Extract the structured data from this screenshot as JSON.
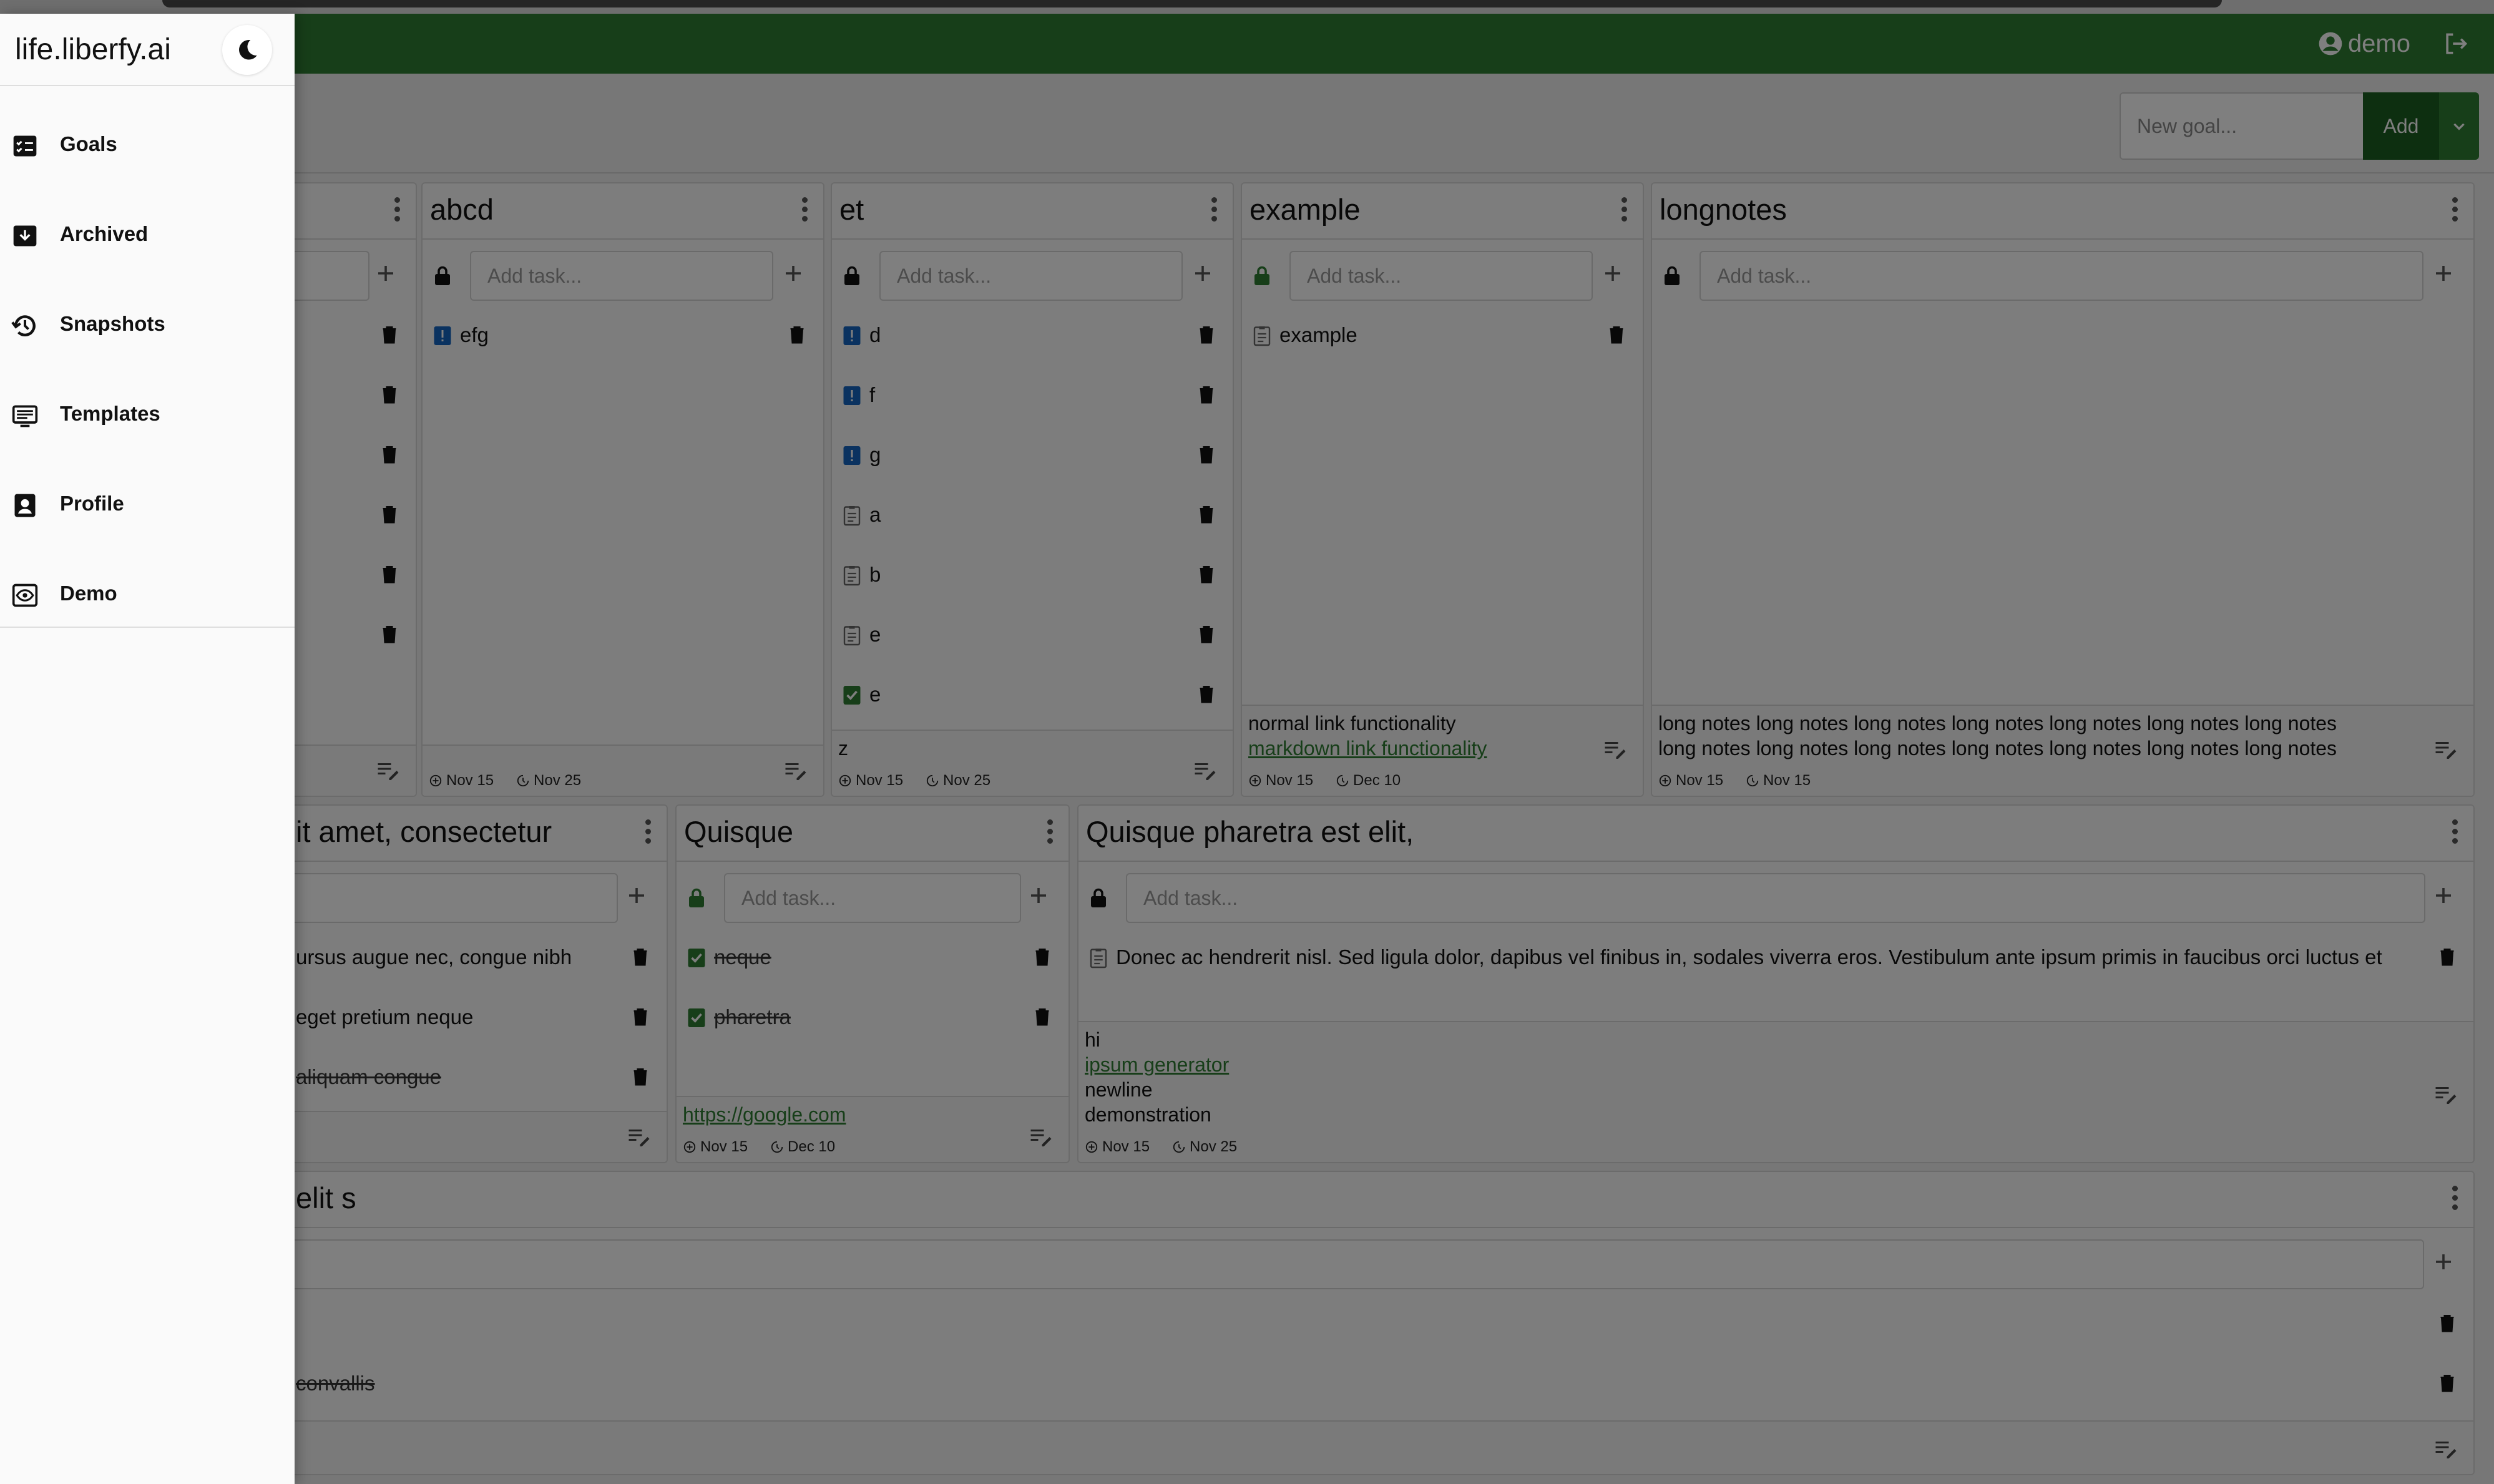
{
  "app": {
    "brand": "life.liberfy.ai",
    "user": "demo"
  },
  "toolbar": {
    "new_goal_placeholder": "New goal...",
    "add_label": "Add"
  },
  "common": {
    "add_task_placeholder": "Add task..."
  },
  "sidebar": {
    "items": [
      {
        "label": "Goals",
        "icon": "goals-checklist-icon"
      },
      {
        "label": "Archived",
        "icon": "archive-box-icon"
      },
      {
        "label": "Snapshots",
        "icon": "history-clock-icon"
      },
      {
        "label": "Templates",
        "icon": "template-list-icon"
      },
      {
        "label": "Profile",
        "icon": "profile-badge-icon"
      },
      {
        "label": "Demo",
        "icon": "demo-eye-icon"
      }
    ]
  },
  "goals": {
    "g0": {
      "title": "",
      "tasks": [
        "",
        "",
        "",
        "",
        "",
        ""
      ],
      "notes": "",
      "created": "",
      "due": ""
    },
    "g1": {
      "title": "abcd",
      "tasks": [
        {
          "text": "efg",
          "icon": "priority"
        }
      ],
      "created": "Nov 15",
      "due": "Nov 25"
    },
    "g2": {
      "title": "et",
      "tasks": [
        {
          "text": "d",
          "icon": "priority"
        },
        {
          "text": "f",
          "icon": "priority"
        },
        {
          "text": "g",
          "icon": "priority"
        },
        {
          "text": "a",
          "icon": "note"
        },
        {
          "text": "b",
          "icon": "note"
        },
        {
          "text": "e",
          "icon": "note"
        },
        {
          "text": "e",
          "icon": "checked"
        }
      ],
      "notes": "z",
      "created": "Nov 15",
      "due": "Nov 25"
    },
    "g3": {
      "title": "example",
      "tasks": [
        {
          "text": "example",
          "icon": "note"
        }
      ],
      "notes_line1": "normal link functionality",
      "notes_link": "markdown link functionality",
      "created": "Nov 15",
      "due": "Dec 10"
    },
    "g4": {
      "title": "longnotes",
      "notes_line1": "long notes long notes long notes long notes long notes long notes long notes",
      "notes_line2": "long notes long notes long notes long notes long notes long notes long notes",
      "created": "Nov 15",
      "due": "Nov 15"
    },
    "g5": {
      "title": "it amet, consectetur",
      "tasks": [
        {
          "text": "ursus augue nec, congue nibh",
          "done": false
        },
        {
          "text": "eget pretium neque",
          "done": false
        },
        {
          "text": "aliquam congue",
          "done": true
        }
      ]
    },
    "g6": {
      "title": "Quisque",
      "tasks": [
        {
          "text": "neque",
          "icon": "checked",
          "done": true
        },
        {
          "text": "pharetra",
          "icon": "checked",
          "done": true
        }
      ],
      "notes_link": "https://google.com",
      "created": "Nov 15",
      "due": "Dec 10"
    },
    "g7": {
      "title": "Quisque pharetra est elit,",
      "tasks": [
        {
          "text": "Donec ac hendrerit nisl. Sed ligula dolor, dapibus vel finibus in, sodales viverra eros. Vestibulum ante ipsum primis in faucibus orci luctus et",
          "icon": "note"
        }
      ],
      "notes_line1": "hi",
      "notes_link": "ipsum generator",
      "notes_line3": "newline",
      "notes_line4": "demonstration",
      "created": "Nov 15",
      "due": "Nov 25"
    },
    "g8": {
      "title": "elit s",
      "tasks": [
        {
          "text": "",
          "done": false
        },
        {
          "text": "convallis",
          "done": true
        }
      ]
    }
  },
  "colors": {
    "header": "#2e7d32",
    "add_button": "#1b5e20",
    "priority": "#1565c0",
    "checked": "#2e7d32",
    "link": "#2e7d32"
  }
}
